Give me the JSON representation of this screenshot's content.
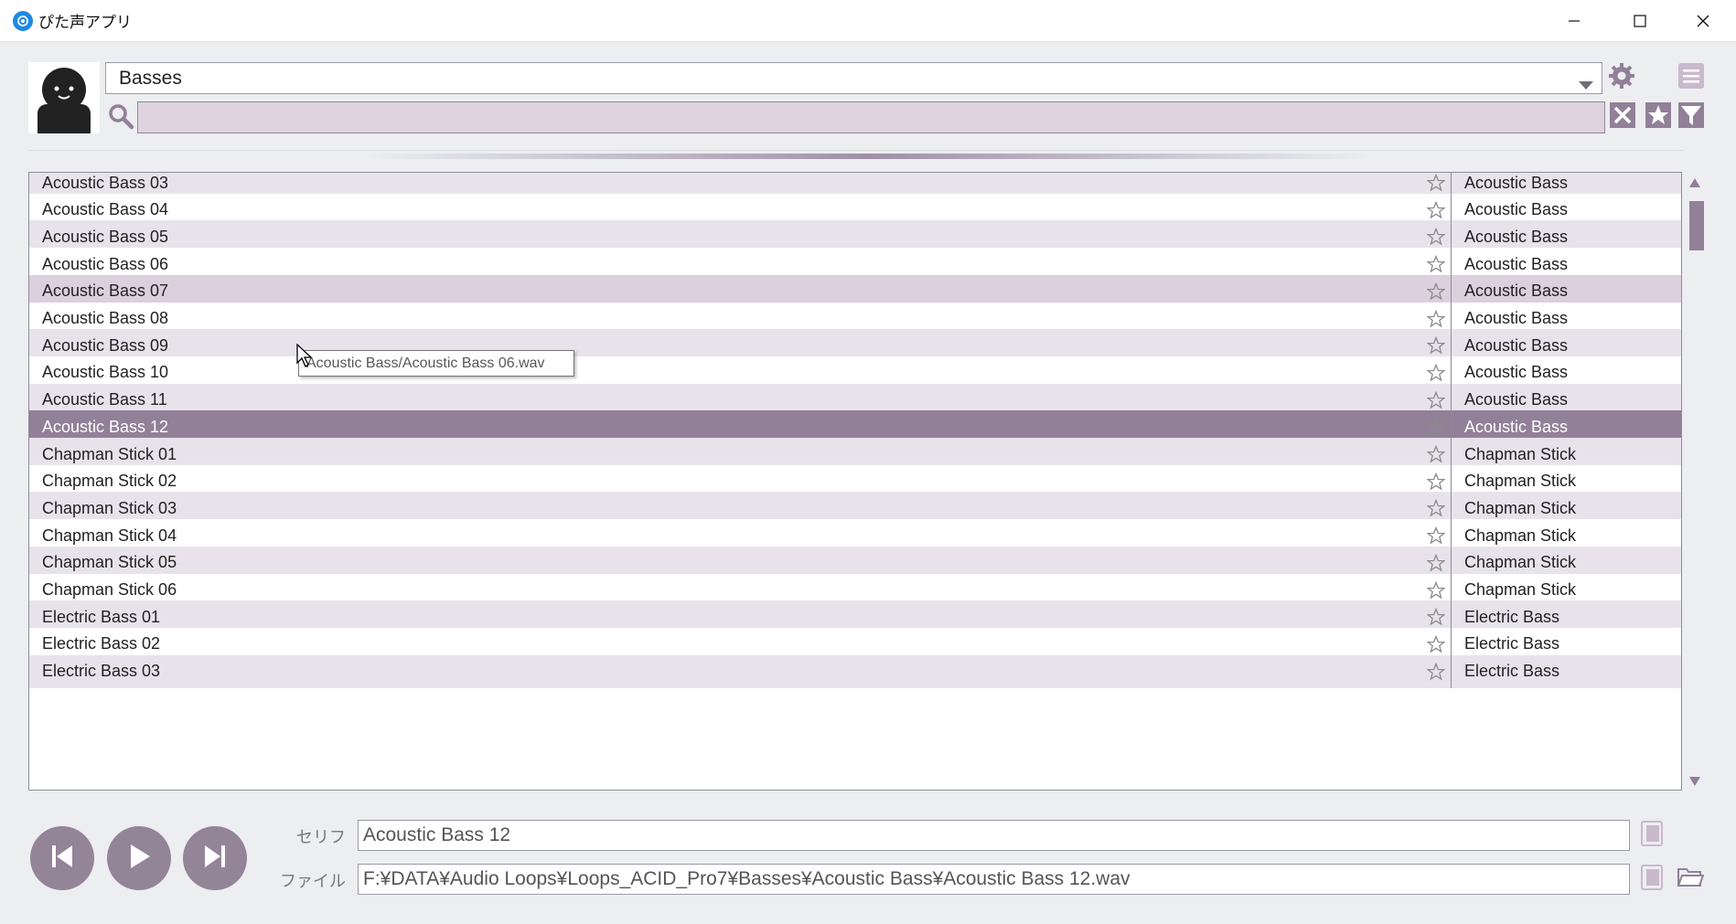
{
  "window": {
    "title": "ぴた声アプリ",
    "icon": "at-sign-icon"
  },
  "header": {
    "category": "Basses",
    "search_value": "",
    "avatar_icon": "character-avatar-icon"
  },
  "list": {
    "rows": [
      {
        "name": "Acoustic Bass 03",
        "category": "Acoustic Bass"
      },
      {
        "name": "Acoustic Bass 04",
        "category": "Acoustic Bass"
      },
      {
        "name": "Acoustic Bass 05",
        "category": "Acoustic Bass"
      },
      {
        "name": "Acoustic Bass 06",
        "category": "Acoustic Bass"
      },
      {
        "name": "Acoustic Bass 07",
        "category": "Acoustic Bass"
      },
      {
        "name": "Acoustic Bass 08",
        "category": "Acoustic Bass"
      },
      {
        "name": "Acoustic Bass 09",
        "category": "Acoustic Bass"
      },
      {
        "name": "Acoustic Bass 10",
        "category": "Acoustic Bass"
      },
      {
        "name": "Acoustic Bass 11",
        "category": "Acoustic Bass"
      },
      {
        "name": "Acoustic Bass 12",
        "category": "Acoustic Bass"
      },
      {
        "name": "Chapman Stick 01",
        "category": "Chapman Stick"
      },
      {
        "name": "Chapman Stick 02",
        "category": "Chapman Stick"
      },
      {
        "name": "Chapman Stick 03",
        "category": "Chapman Stick"
      },
      {
        "name": "Chapman Stick 04",
        "category": "Chapman Stick"
      },
      {
        "name": "Chapman Stick 05",
        "category": "Chapman Stick"
      },
      {
        "name": "Chapman Stick 06",
        "category": "Chapman Stick"
      },
      {
        "name": "Electric Bass 01",
        "category": "Electric Bass"
      },
      {
        "name": "Electric Bass 02",
        "category": "Electric Bass"
      },
      {
        "name": "Electric Bass 03",
        "category": "Electric Bass"
      }
    ],
    "selected_index": 9,
    "hover_index": 4,
    "tooltip": "Acoustic Bass/Acoustic Bass 06.wav"
  },
  "player": {
    "serif_label": "セリフ",
    "serif_value": "Acoustic Bass 12",
    "file_label": "ファイル",
    "file_value": "F:¥DATA¥Audio Loops¥Loops_ACID_Pro7¥Basses¥Acoustic Bass¥Acoustic Bass 12.wav"
  },
  "colors": {
    "accent": "#918098",
    "row_alt": "#e8e3eb",
    "search_bg": "#ded3df"
  }
}
